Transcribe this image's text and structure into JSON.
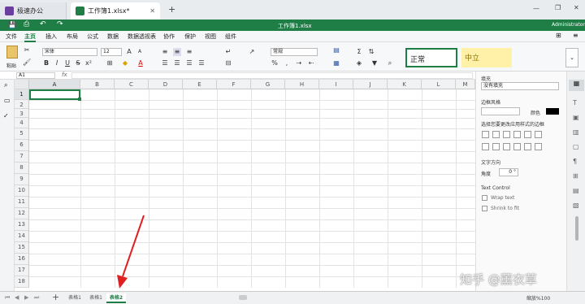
{
  "tabs": {
    "home": "极速办公",
    "doc": "工作簿1.xlsx*",
    "new_tab": "+"
  },
  "window": {
    "min": "—",
    "restore": "❐",
    "close": "✕"
  },
  "titlebar": {
    "title": "工作簿1.xlsx",
    "user": "Administrator"
  },
  "menu": [
    "文件",
    "主页",
    "插入",
    "布局",
    "公式",
    "数据",
    "数据透视表",
    "协作",
    "保护",
    "视图",
    "组件"
  ],
  "ribbon": {
    "paste": "粘贴",
    "font": "宋体",
    "size": "12",
    "numfmt": "常规",
    "style_normal": "正常",
    "style_neutral": "中立"
  },
  "formula": {
    "cellref": "A1",
    "fx": "fx"
  },
  "columns": [
    "A",
    "B",
    "C",
    "D",
    "E",
    "F",
    "G",
    "H",
    "I",
    "J",
    "K",
    "L",
    "M"
  ],
  "rows": [
    "1",
    "2",
    "3",
    "4",
    "5",
    "6",
    "7",
    "8",
    "9",
    "10",
    "11",
    "12",
    "13",
    "14",
    "15",
    "16",
    "17",
    "18"
  ],
  "sheets": [
    "表格1",
    "表格1",
    "表格2"
  ],
  "panel": {
    "fill_title": "填充",
    "fill_value": "没有填充",
    "border_title": "边框风格",
    "color_label": "颜色",
    "border_hint": "选择您要更改应用样式的边框",
    "text_dir_title": "文字方向",
    "angle_label": "角度",
    "angle_value": "0 °",
    "text_control": "Text Control",
    "wrap": "Wrap text",
    "shrink": "Shrink to fit"
  },
  "status": {
    "zoom": "缩放%100"
  },
  "watermark": "知乎 @薰衣草",
  "colors": {
    "green": "#1e7e45",
    "neutral_fill": "#fff2a8",
    "arrow": "#e02020"
  }
}
